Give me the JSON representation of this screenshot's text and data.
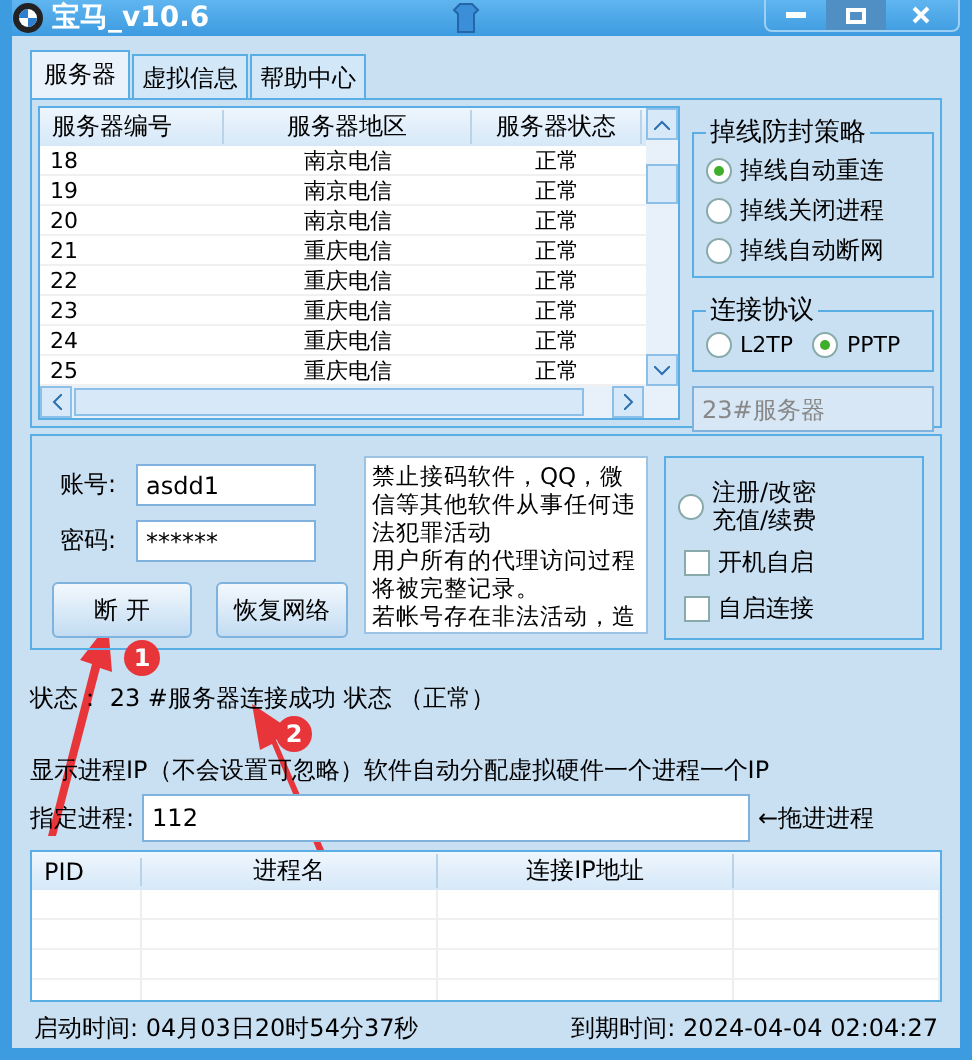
{
  "window": {
    "title": "宝马_v10.6"
  },
  "tabs": [
    {
      "label": "服务器",
      "selected": true
    },
    {
      "label": "虚拟信息",
      "selected": false
    },
    {
      "label": "帮助中心",
      "selected": false
    }
  ],
  "servers": {
    "columns": [
      "服务器编号",
      "服务器地区",
      "服务器状态"
    ],
    "rows": [
      [
        "18",
        "南京电信",
        "正常"
      ],
      [
        "19",
        "南京电信",
        "正常"
      ],
      [
        "20",
        "南京电信",
        "正常"
      ],
      [
        "21",
        "重庆电信",
        "正常"
      ],
      [
        "22",
        "重庆电信",
        "正常"
      ],
      [
        "23",
        "重庆电信",
        "正常"
      ],
      [
        "24",
        "重庆电信",
        "正常"
      ],
      [
        "25",
        "重庆电信",
        "正常"
      ]
    ]
  },
  "reconnect_group": {
    "title": "掉线防封策略",
    "options": [
      {
        "label": "掉线自动重连",
        "selected": true
      },
      {
        "label": "掉线关闭进程",
        "selected": false
      },
      {
        "label": "掉线自动断网",
        "selected": false
      }
    ]
  },
  "protocol_group": {
    "title": "连接协议",
    "options": [
      {
        "label": "L2TP",
        "selected": false
      },
      {
        "label": "PPTP",
        "selected": true
      }
    ]
  },
  "server_field": {
    "value": "23#服务器"
  },
  "login": {
    "account_label": "账号:",
    "account": "asdd1",
    "password_label": "密码:",
    "password": "******",
    "buttons": [
      "断 开",
      "恢复网络"
    ]
  },
  "notice": [
    "禁止接码软件，QQ，微信等其他软件从事任何违法犯罪活动",
    "用户所有的代理访问过程将被完整记录。",
    "若帐号存在非法活动，造"
  ],
  "options": [
    {
      "kind": "radio",
      "label": "注册/改密充值/续费",
      "selected": false
    },
    {
      "kind": "checkbox",
      "label": "开机自启",
      "checked": false
    },
    {
      "kind": "checkbox",
      "label": "自启连接",
      "checked": false
    }
  ],
  "status_line": "状态： 23 #服务器连接成功 状态 （正常）",
  "ip_line": "显示进程IP（不会设置可忽略）软件自动分配虚拟硬件一个进程一个IP",
  "process": {
    "label": "指定进程:",
    "value": "112",
    "hint": "←拖进进程"
  },
  "process_table": {
    "columns": [
      "PID",
      "进程名",
      "连接IP地址"
    ]
  },
  "footer": {
    "start_label": "启动时间:",
    "start": "04月03日20时54分37秒",
    "expire_label": "到期时间:",
    "expire": "2024-04-04 02:04:27"
  },
  "annotations": [
    "1",
    "2"
  ]
}
